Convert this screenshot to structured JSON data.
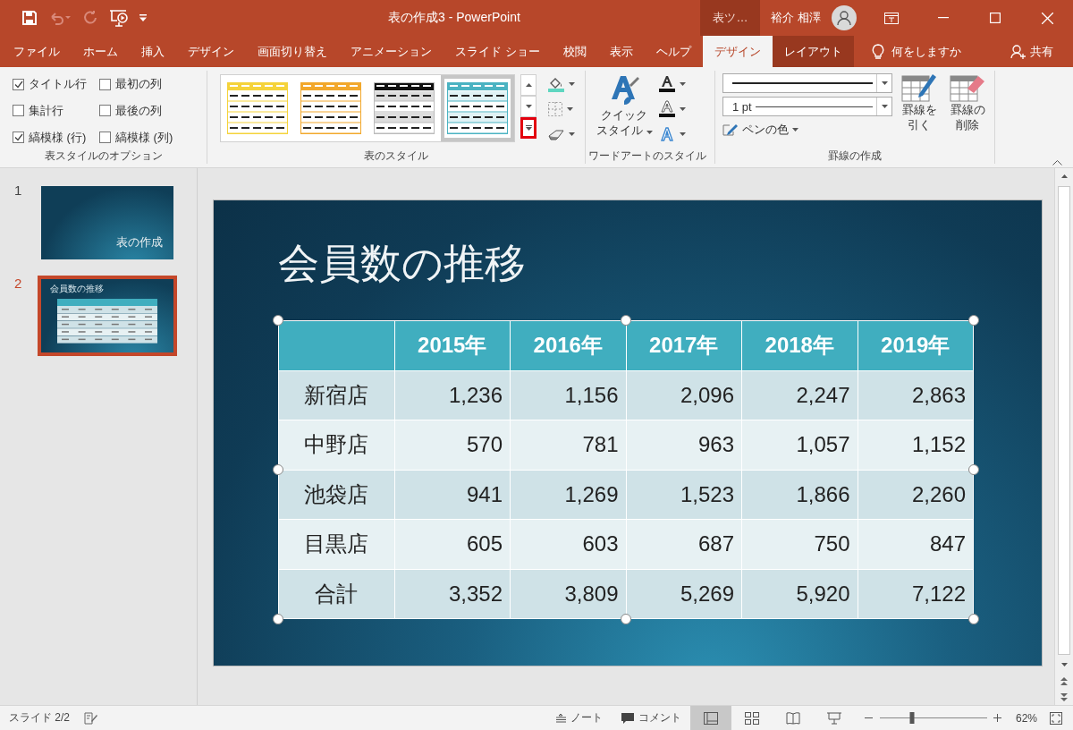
{
  "title_bar": {
    "title": "表の作成3 - PowerPoint",
    "context_label": "表ツ…",
    "user": "裕介 相澤"
  },
  "tabs": [
    {
      "label": "ファイル",
      "kind": "main",
      "selected": false
    },
    {
      "label": "ホーム",
      "kind": "main",
      "selected": false
    },
    {
      "label": "挿入",
      "kind": "main",
      "selected": false
    },
    {
      "label": "デザイン",
      "kind": "main",
      "selected": false
    },
    {
      "label": "画面切り替え",
      "kind": "main",
      "selected": false
    },
    {
      "label": "アニメーション",
      "kind": "main",
      "selected": false
    },
    {
      "label": "スライド ショー",
      "kind": "main",
      "selected": false
    },
    {
      "label": "校閲",
      "kind": "main",
      "selected": false
    },
    {
      "label": "表示",
      "kind": "main",
      "selected": false
    },
    {
      "label": "ヘルプ",
      "kind": "main",
      "selected": false
    },
    {
      "label": "デザイン",
      "kind": "context",
      "selected": true
    },
    {
      "label": "レイアウト",
      "kind": "context",
      "selected": false
    }
  ],
  "tell_me": {
    "placeholder": "何をしますか"
  },
  "share": "共有",
  "ribbon": {
    "options": {
      "label": "表スタイルのオプション",
      "checkboxes": [
        {
          "label": "タイトル行",
          "checked": true
        },
        {
          "label": "最初の列",
          "checked": false
        },
        {
          "label": "集計行",
          "checked": false
        },
        {
          "label": "最後の列",
          "checked": false
        },
        {
          "label": "縞模様 (行)",
          "checked": true
        },
        {
          "label": "縞模様 (列)",
          "checked": false
        }
      ]
    },
    "styles": {
      "label": "表のスタイル",
      "more_highlighted": true,
      "items": [
        {
          "color": "#f5d33a",
          "selected": false
        },
        {
          "color": "#f2a82c",
          "selected": false
        },
        {
          "color": "#111111",
          "selected": false
        },
        {
          "color": "#4bb3c2",
          "selected": true
        }
      ]
    },
    "wordart": {
      "label": "ワードアートのスタイル",
      "quick_style": [
        "クイック",
        "スタイル"
      ]
    },
    "borders": {
      "label": "罫線の作成",
      "weight": "1 pt",
      "pen_color": "ペンの色",
      "draw": [
        "罫線を",
        "引く"
      ],
      "erase": [
        "罫線の",
        "削除"
      ]
    }
  },
  "slides": [
    {
      "number": "1",
      "selected": false,
      "title": "表の作成"
    },
    {
      "number": "2",
      "selected": true,
      "title": "会員数の推移"
    }
  ],
  "slide": {
    "title": "会員数の推移",
    "table": {
      "columns": [
        "",
        "2015年",
        "2016年",
        "2017年",
        "2018年",
        "2019年"
      ],
      "rows": [
        [
          "新宿店",
          "1,236",
          "1,156",
          "2,096",
          "2,247",
          "2,863"
        ],
        [
          "中野店",
          "570",
          "781",
          "963",
          "1,057",
          "1,152"
        ],
        [
          "池袋店",
          "941",
          "1,269",
          "1,523",
          "1,866",
          "2,260"
        ],
        [
          "目黒店",
          "605",
          "603",
          "687",
          "750",
          "847"
        ],
        [
          "合計",
          "3,352",
          "3,809",
          "5,269",
          "5,920",
          "7,122"
        ]
      ]
    }
  },
  "status_bar": {
    "slide": "スライド 2/2",
    "notes": "ノート",
    "comments": "コメント",
    "views": [
      {
        "selected": true
      },
      {
        "selected": false
      },
      {
        "selected": false
      },
      {
        "selected": false
      }
    ],
    "zoom": {
      "level": 0.3
    },
    "zoom_value": "62%"
  }
}
